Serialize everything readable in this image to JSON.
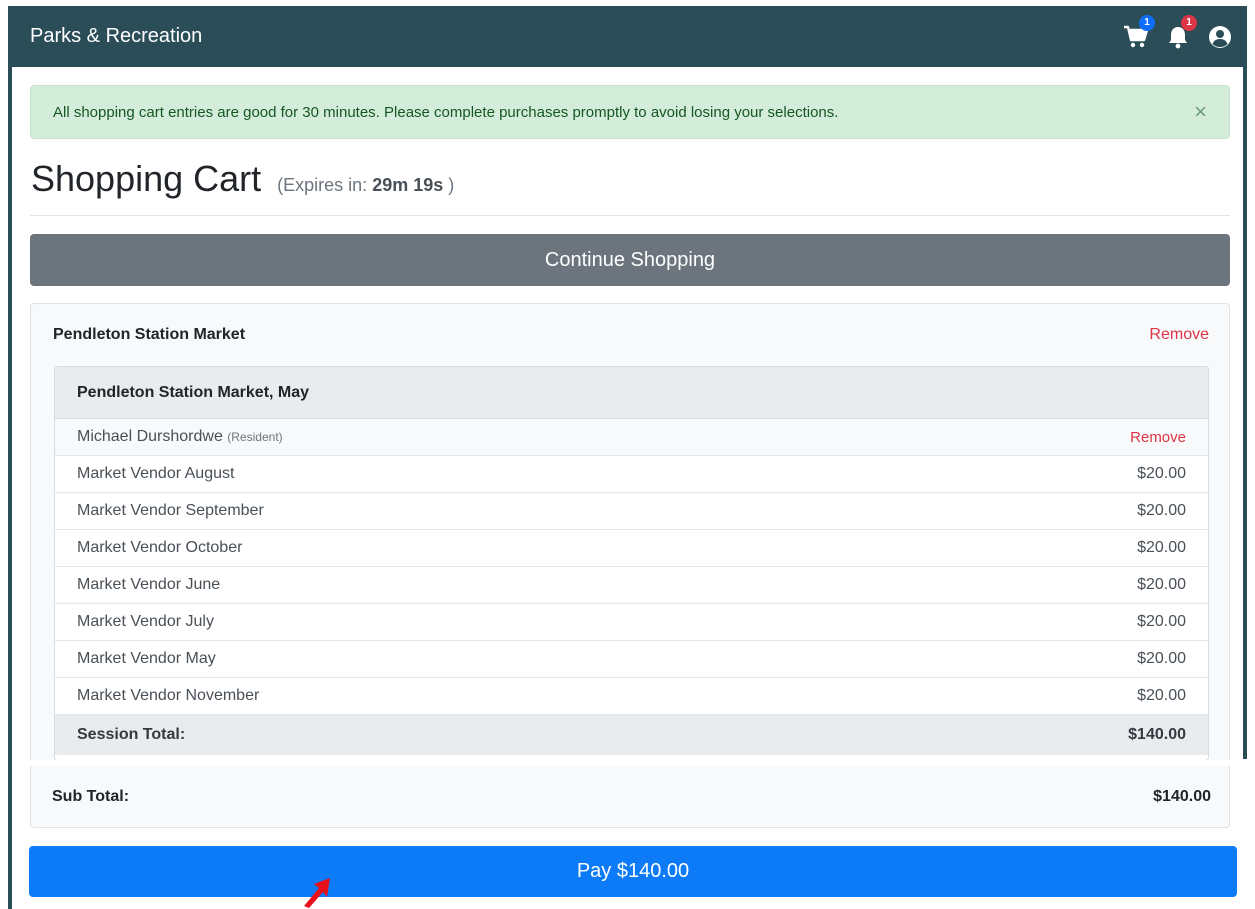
{
  "app": {
    "title": "Parks & Recreation"
  },
  "nav": {
    "icons": [
      "shopping-cart-icon",
      "bell-icon",
      "user-circle-icon"
    ],
    "cart_badge": "1",
    "notifications_badge": "1"
  },
  "alert": {
    "message": "All shopping cart entries are good for 30 minutes. Please complete purchases promptly to avoid losing your selections.",
    "close_glyph": "×"
  },
  "page": {
    "title": "Shopping Cart",
    "expires_prefix": "(Expires in:",
    "expires_value": "29m 19s",
    "expires_suffix": ")"
  },
  "buttons": {
    "continue_label": "Continue Shopping",
    "pay_label": "Pay $140.00"
  },
  "cart": {
    "vendor": "Pendleton Station Market",
    "vendor_remove": "Remove",
    "session": {
      "title": "Pendleton Station Market, May",
      "participant": "Michael Durshordwe",
      "participant_type": "(Resident)",
      "participant_remove": "Remove",
      "items": [
        {
          "name": "Market Vendor August",
          "price": "$20.00"
        },
        {
          "name": "Market Vendor September",
          "price": "$20.00"
        },
        {
          "name": "Market Vendor October",
          "price": "$20.00"
        },
        {
          "name": "Market Vendor June",
          "price": "$20.00"
        },
        {
          "name": "Market Vendor July",
          "price": "$20.00"
        },
        {
          "name": "Market Vendor May",
          "price": "$20.00"
        },
        {
          "name": "Market Vendor November",
          "price": "$20.00"
        }
      ],
      "total_label": "Session Total:",
      "total_value": "$140.00"
    },
    "subtotal_label": "Sub Total:",
    "subtotal_value": "$140.00"
  },
  "colors": {
    "navbar": "#2a4d58",
    "alert_bg": "#d4edda",
    "continue_button": "#6c757d",
    "pay_button": "#0d7bf7",
    "remove_link": "#dc3545",
    "cursor_annotation": "#e8101a"
  }
}
